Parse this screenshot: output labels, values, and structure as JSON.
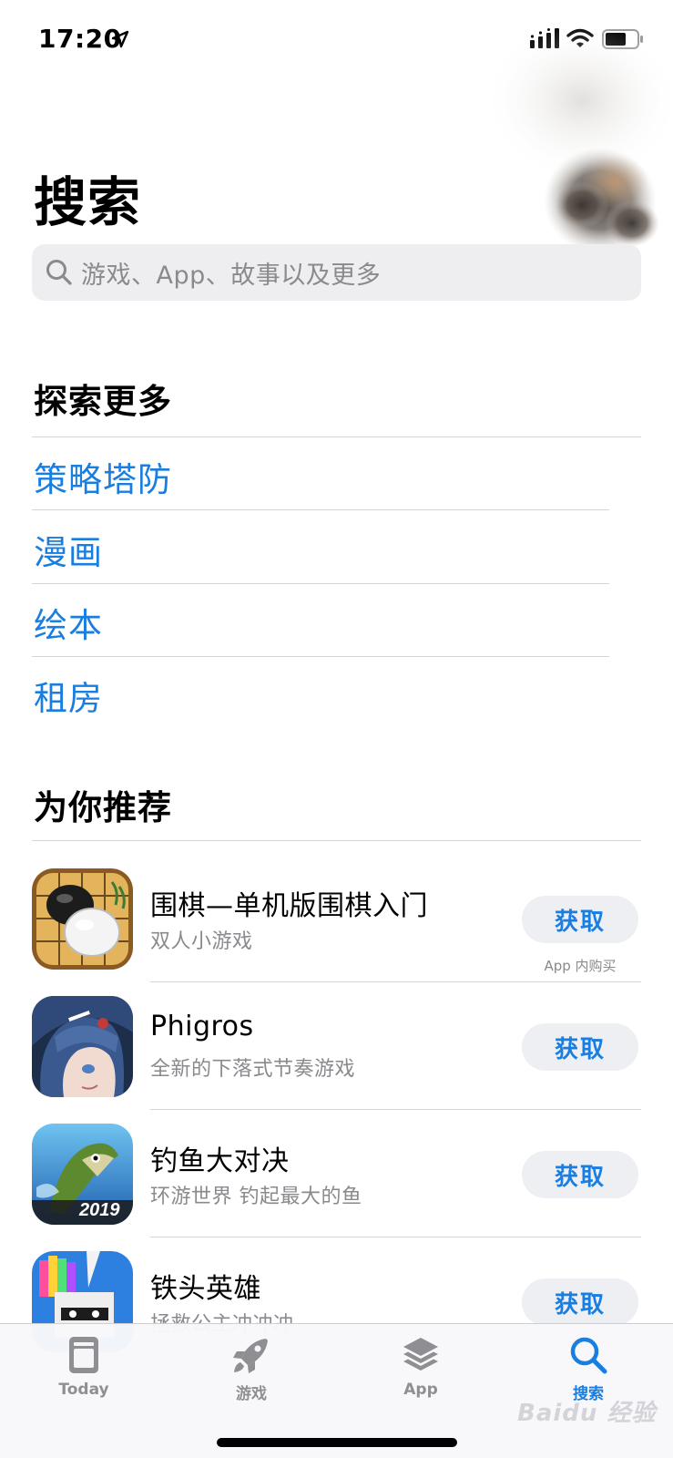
{
  "status_bar": {
    "time": "17:20"
  },
  "page": {
    "title": "搜索"
  },
  "search": {
    "placeholder": "游戏、App、故事以及更多"
  },
  "explore": {
    "title": "探索更多",
    "items": [
      {
        "label": "策略塔防"
      },
      {
        "label": "漫画"
      },
      {
        "label": "绘本"
      },
      {
        "label": "租房"
      }
    ]
  },
  "recommended": {
    "title": "为你推荐",
    "apps": [
      {
        "name": "围棋—单机版围棋入门",
        "desc": "双人小游戏",
        "button": "获取",
        "note": "App 内购买",
        "icon": "go-board-icon"
      },
      {
        "name": "Phigros",
        "desc": "全新的下落式节奏游戏",
        "button": "获取",
        "note": "",
        "icon": "anime-girl-icon"
      },
      {
        "name": "钓鱼大对决",
        "desc": "环游世界  钓起最大的鱼",
        "button": "获取",
        "note": "",
        "icon": "fish-icon",
        "icon_badge": "2019"
      },
      {
        "name": "铁头英雄",
        "desc": "拯救公主冲冲冲",
        "button": "获取",
        "note": "",
        "icon": "knight-icon"
      }
    ]
  },
  "tab_bar": {
    "tabs": [
      {
        "label": "Today",
        "icon": "today-icon"
      },
      {
        "label": "游戏",
        "icon": "rocket-icon"
      },
      {
        "label": "App",
        "icon": "layers-icon"
      },
      {
        "label": "搜索",
        "icon": "search-icon",
        "active": true
      }
    ]
  },
  "watermark": "Baidu 经验",
  "colors": {
    "accent": "#1a7ee0",
    "secondary_text": "#8a8a8e",
    "search_bg": "#eeeef0"
  }
}
